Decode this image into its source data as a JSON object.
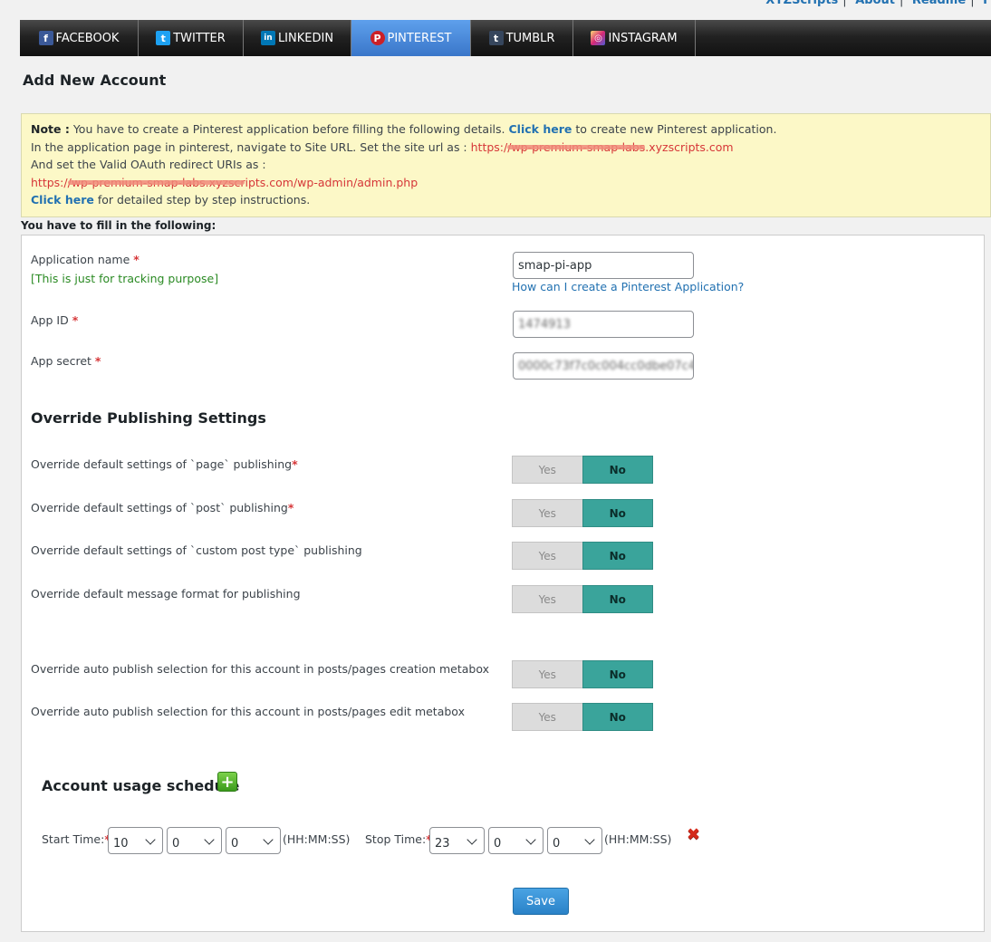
{
  "top_links": [
    "XYZScripts",
    "About",
    "Readme",
    "F"
  ],
  "tabs": [
    {
      "label": "FACEBOOK",
      "icon": "facebook-icon",
      "glyph": "f",
      "color": "#3b5998",
      "active": false
    },
    {
      "label": "TWITTER",
      "icon": "twitter-icon",
      "glyph": "t",
      "color": "#1da1f2",
      "active": false
    },
    {
      "label": "LINKEDIN",
      "icon": "linkedin-icon",
      "glyph": "in",
      "color": "#0077b5",
      "active": false
    },
    {
      "label": "PINTEREST",
      "icon": "pinterest-icon",
      "glyph": "P",
      "color": "#cb2027",
      "active": true
    },
    {
      "label": "TUMBLR",
      "icon": "tumblr-icon",
      "glyph": "t",
      "color": "#36465d",
      "active": false
    },
    {
      "label": "INSTAGRAM",
      "icon": "instagram-icon",
      "glyph": "◎",
      "color": "#c13584",
      "active": false
    }
  ],
  "page_title": "Add New Account",
  "note": {
    "line1_label": "Note :",
    "line1_text": " You have to create a Pinterest application before filling the following details. ",
    "line1_link": "Click here",
    "line1_tail": " to create new Pinterest application.",
    "line2_text": "In the application page in pinterest, navigate to Site URL. Set the site url as : ",
    "line2_prefix": "https:/",
    "line2_redacted": "/wp-premium-smap-labs",
    "line2_suffix": ".xyzscripts.com",
    "line3_text": "And set the Valid OAuth redirect URIs as :",
    "line4_prefix": "https:/",
    "line4_redacted": "/wp-premium-smap-labs.xyzscr",
    "line4_suffix": "ipts.com/wp-admin/admin.php",
    "line5_link": "Click here",
    "line5_tail": " for detailed step by step instructions."
  },
  "fill_heading": "You have to fill in the following:",
  "form": {
    "app_name_label": "Application name",
    "app_name_note": "[This is just for tracking purpose]",
    "app_name_value": "smap-pi-app",
    "help_link": "How can I create a Pinterest Application?",
    "app_id_label": "App ID",
    "app_id_value": "1474913",
    "app_secret_label": "App secret",
    "app_secret_value": "0000c73f7c0c004cc0dbe07c4"
  },
  "override": {
    "heading": "Override Publishing Settings",
    "yes_label": "Yes",
    "no_label": "No",
    "rows": [
      {
        "label": "Override default settings of `page` publishing",
        "required": true,
        "value": "No"
      },
      {
        "label": "Override default settings of `post` publishing",
        "required": true,
        "value": "No"
      },
      {
        "label": "Override default settings of `custom post type` publishing",
        "required": false,
        "value": "No"
      },
      {
        "label": "Override default message format for publishing",
        "required": false,
        "value": "No"
      },
      {
        "label": "Override auto publish selection for this account in posts/pages creation metabox",
        "required": false,
        "value": "No"
      },
      {
        "label": "Override auto publish selection for this account in posts/pages edit metabox",
        "required": false,
        "value": "No"
      }
    ]
  },
  "schedule": {
    "heading": "Account usage schedule",
    "start_label": "Start Time:",
    "stop_label": "Stop Time:",
    "format_hint": "(HH:MM:SS)",
    "start": {
      "hh": "10",
      "mm": "0",
      "ss": "0"
    },
    "stop": {
      "hh": "23",
      "mm": "0",
      "ss": "0"
    }
  },
  "save_label": "Save",
  "colors": {
    "toggle_on": "#3aa49b",
    "tab_active": "#4a8ee0",
    "note_bg": "#fcf8c7",
    "required": "#d63638"
  }
}
